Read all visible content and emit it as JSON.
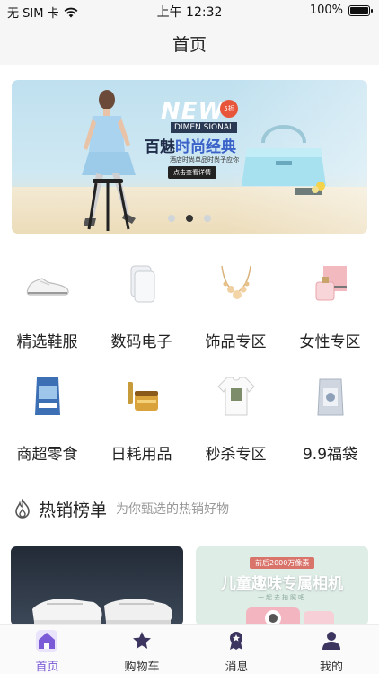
{
  "status_bar": {
    "carrier": "无 SIM 卡",
    "time": "上午 12:32",
    "battery_text": "100%",
    "battery_level": 1.0
  },
  "nav": {
    "title": "首页"
  },
  "banner": {
    "new_text": "NEW",
    "badge_text": "5折",
    "english_sub": "DIMEN SIONAL",
    "headline_prefix": "百魅",
    "headline_main": "时尚经典",
    "tagline": "酒店时尚单品时尚予应你",
    "cta": "点击查看详情",
    "dots": 3,
    "active_dot": 1
  },
  "categories": [
    {
      "label": "精选鞋服",
      "icon": "sneaker-icon"
    },
    {
      "label": "数码电子",
      "icon": "powerbank-icon"
    },
    {
      "label": "饰品专区",
      "icon": "necklace-icon"
    },
    {
      "label": "女性专区",
      "icon": "perfume-icon"
    },
    {
      "label": "商超零食",
      "icon": "snack-bag-icon"
    },
    {
      "label": "日耗用品",
      "icon": "cream-jar-icon"
    },
    {
      "label": "秒杀专区",
      "icon": "tshirt-icon"
    },
    {
      "label": "9.9福袋",
      "icon": "gift-pouch-icon"
    }
  ],
  "hot_section": {
    "title": "热销榜单",
    "subtitle": "为你甄选的热销好物",
    "icon": "flame-icon"
  },
  "cards": {
    "right_tag": "前后2000万像素",
    "right_title": "儿童趣味专属相机",
    "right_sub": "一起去拍照吧"
  },
  "tabs": [
    {
      "label": "首页",
      "icon": "home-icon",
      "active": true
    },
    {
      "label": "购物车",
      "icon": "star-icon",
      "active": false
    },
    {
      "label": "消息",
      "icon": "award-icon",
      "active": false
    },
    {
      "label": "我的",
      "icon": "user-icon",
      "active": false
    }
  ],
  "colors": {
    "accent": "#7a5ad6",
    "text": "#222222",
    "muted": "#999999"
  }
}
